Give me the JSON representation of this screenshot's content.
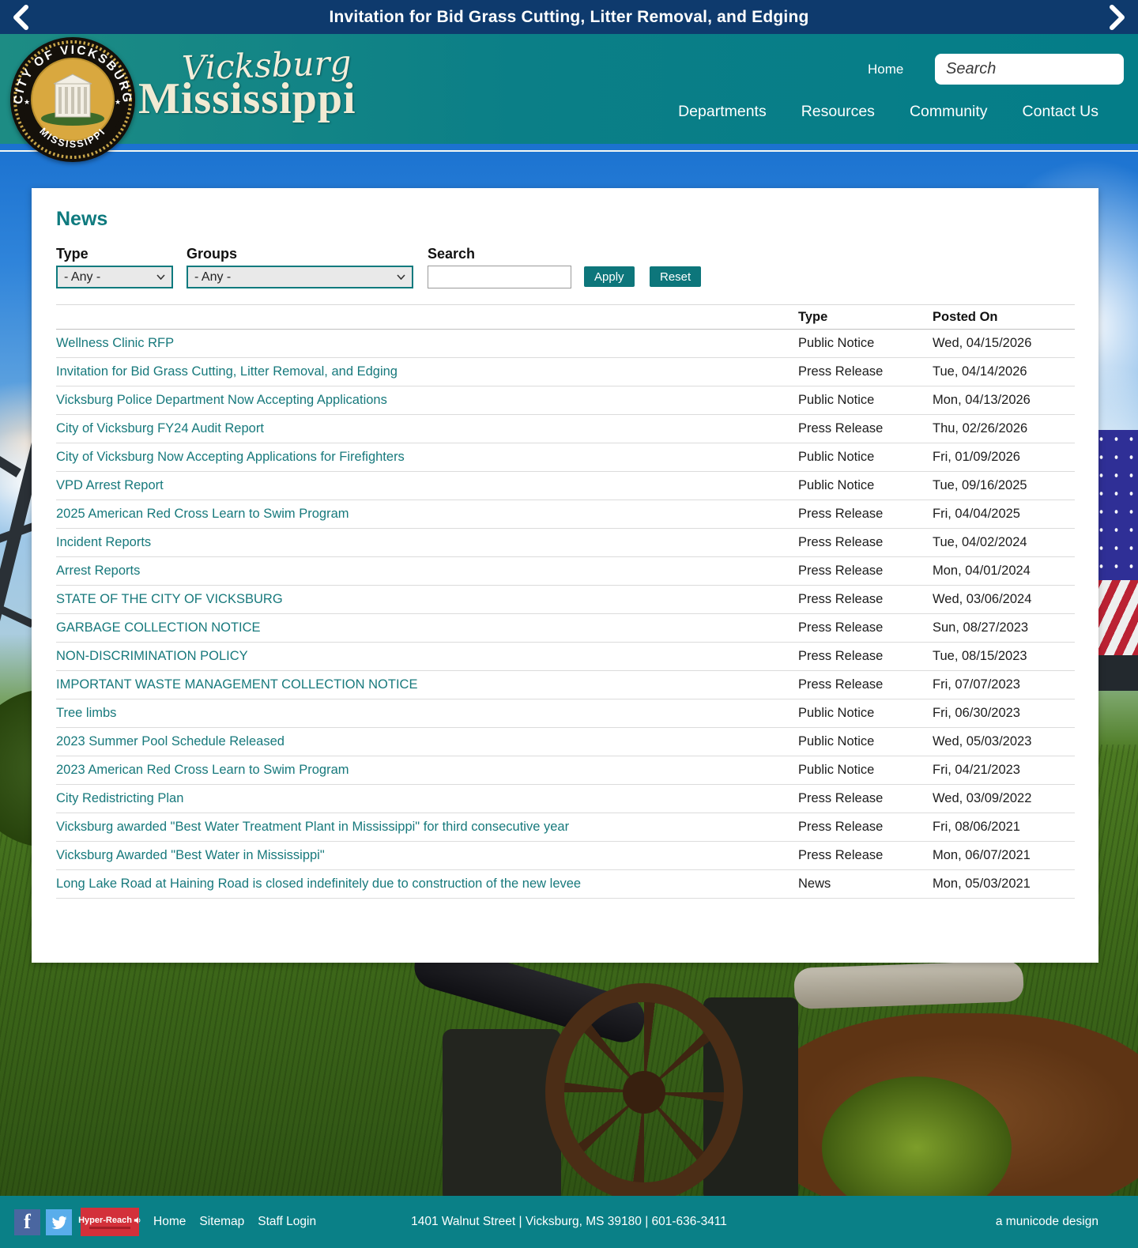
{
  "banner": {
    "title": "Invitation for Bid Grass Cutting, Litter Removal, and Edging",
    "prev_icon": "chevron-left-icon",
    "next_icon": "chevron-right-icon"
  },
  "header": {
    "seal_top": "CITY OF VICKSBURG",
    "seal_bottom": "MISSISSIPPI",
    "seal_star": "★",
    "wordmark_script": "Vicksburg",
    "wordmark_main": "Mississippi",
    "home_label": "Home",
    "search_placeholder": "Search",
    "search_icon": "magnifier-icon",
    "nav": [
      {
        "label": "Departments"
      },
      {
        "label": "Resources"
      },
      {
        "label": "Community"
      },
      {
        "label": "Contact Us"
      }
    ]
  },
  "news": {
    "title": "News",
    "filters": {
      "type_label": "Type",
      "groups_label": "Groups",
      "search_label": "Search",
      "type_value": "- Any -",
      "groups_value": "- Any -",
      "search_value": "",
      "apply_label": "Apply",
      "reset_label": "Reset"
    },
    "table": {
      "columns": {
        "type": "Type",
        "posted_on": "Posted On"
      },
      "rows": [
        {
          "title": "Wellness Clinic RFP",
          "type": "Public Notice",
          "posted_on": "Wed, 04/15/2026"
        },
        {
          "title": "Invitation for Bid Grass Cutting, Litter Removal, and Edging",
          "type": "Press Release",
          "posted_on": "Tue, 04/14/2026"
        },
        {
          "title": "Vicksburg Police Department Now Accepting Applications",
          "type": "Public Notice",
          "posted_on": "Mon, 04/13/2026"
        },
        {
          "title": "City of Vicksburg FY24 Audit Report",
          "type": "Press Release",
          "posted_on": "Thu, 02/26/2026"
        },
        {
          "title": "City of Vicksburg Now Accepting Applications for Firefighters",
          "type": "Public Notice",
          "posted_on": "Fri, 01/09/2026"
        },
        {
          "title": "VPD Arrest Report",
          "type": "Public Notice",
          "posted_on": "Tue, 09/16/2025"
        },
        {
          "title": "2025 American Red Cross Learn to Swim Program",
          "type": "Press Release",
          "posted_on": "Fri, 04/04/2025"
        },
        {
          "title": "Incident Reports",
          "type": "Press Release",
          "posted_on": "Tue, 04/02/2024"
        },
        {
          "title": "Arrest Reports",
          "type": "Press Release",
          "posted_on": "Mon, 04/01/2024"
        },
        {
          "title": "STATE OF THE CITY OF VICKSBURG",
          "type": "Press Release",
          "posted_on": "Wed, 03/06/2024"
        },
        {
          "title": "GARBAGE COLLECTION NOTICE",
          "type": "Press Release",
          "posted_on": "Sun, 08/27/2023"
        },
        {
          "title": "NON-DISCRIMINATION POLICY",
          "type": "Press Release",
          "posted_on": "Tue, 08/15/2023"
        },
        {
          "title": "IMPORTANT WASTE MANAGEMENT COLLECTION NOTICE",
          "type": "Press Release",
          "posted_on": "Fri, 07/07/2023"
        },
        {
          "title": "Tree limbs",
          "type": "Public Notice",
          "posted_on": "Fri, 06/30/2023"
        },
        {
          "title": "2023 Summer Pool Schedule Released",
          "type": "Public Notice",
          "posted_on": "Wed, 05/03/2023"
        },
        {
          "title": "2023 American Red Cross Learn to Swim Program",
          "type": "Public Notice",
          "posted_on": "Fri, 04/21/2023"
        },
        {
          "title": "City Redistricting Plan",
          "type": "Press Release",
          "posted_on": "Wed, 03/09/2022"
        },
        {
          "title": "Vicksburg awarded \"Best Water Treatment Plant in Mississippi\" for third consecutive year",
          "type": "Press Release",
          "posted_on": "Fri, 08/06/2021"
        },
        {
          "title": "Vicksburg Awarded \"Best Water in Mississippi\"",
          "type": "Press Release",
          "posted_on": "Mon, 06/07/2021"
        },
        {
          "title": "Long Lake Road at Haining Road is closed indefinitely due to construction of the new levee",
          "type": "News",
          "posted_on": "Mon, 05/03/2021"
        }
      ]
    }
  },
  "footer": {
    "facebook_icon": "facebook-icon",
    "facebook_glyph": "f",
    "twitter_icon": "twitter-icon",
    "hyperreach_label": "Hyper-Reach",
    "links": [
      {
        "label": "Home"
      },
      {
        "label": "Sitemap"
      },
      {
        "label": "Staff Login"
      }
    ],
    "address": "1401 Walnut Street | Vicksburg, MS 39180 | 601-636-3411",
    "credit": "a municode design"
  },
  "colors": {
    "banner_navy": "#0e3a6d",
    "header_teal": "#0b7f87",
    "footer_teal": "#0a8087",
    "link_teal": "#17797c",
    "heading_teal": "#0e7a7e",
    "button_teal": "#0d767b",
    "facebook_blue": "#4a66a0",
    "twitter_blue": "#59adeb",
    "hyperreach_red": "#d3303a"
  }
}
